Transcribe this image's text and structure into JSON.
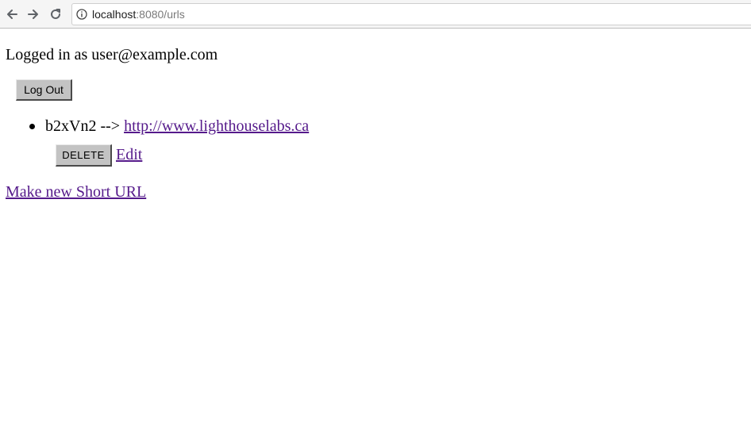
{
  "browser": {
    "url_host": "localhost",
    "url_path": ":8080/urls",
    "icons": {
      "back": "back-arrow-icon",
      "forward": "forward-arrow-icon",
      "reload": "reload-icon",
      "info": "info-icon"
    }
  },
  "page": {
    "logged_in_text": "Logged in as user@example.com",
    "logout_label": "Log Out",
    "urls": [
      {
        "short": "b2xVn2",
        "arrow": " --> ",
        "long": "http://www.lighthouselabs.ca",
        "delete_label": "DELETE",
        "edit_label": "Edit"
      }
    ],
    "new_url_label": "Make new Short URL"
  },
  "colors": {
    "visited_link": "#551a8b",
    "button_gray": "#c3c3c3"
  }
}
